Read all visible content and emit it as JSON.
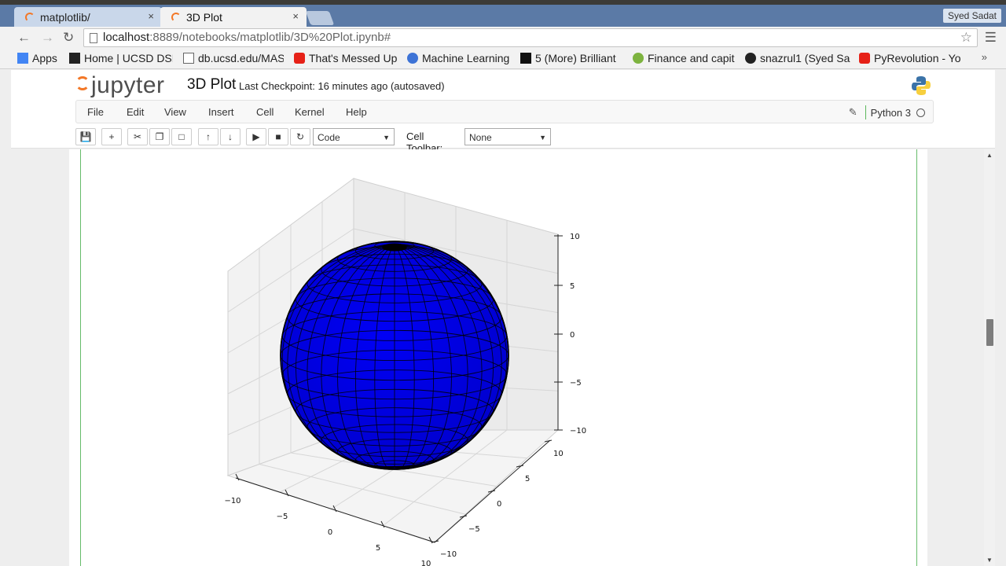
{
  "browser": {
    "tabs": [
      {
        "title": "matplotlib/",
        "active": false
      },
      {
        "title": "3D Plot",
        "active": true
      }
    ],
    "close_glyph": "×",
    "profile_name": "Syed Sadat",
    "url_host": "localhost",
    "url_path": ":8889/notebooks/matplotlib/3D%20Plot.ipynb#",
    "bookmarks": [
      {
        "label": "Apps",
        "icon": "apps-grid-icon"
      },
      {
        "label": "Home | UCSD DSE",
        "icon": "ds-icon"
      },
      {
        "label": "db.ucsd.edu/MAS",
        "icon": "page-icon"
      },
      {
        "label": "That's Messed Up",
        "icon": "youtube-icon"
      },
      {
        "label": "Machine Learning",
        "icon": "link-icon"
      },
      {
        "label": "5 (More) Brilliant",
        "icon": "medium-icon"
      },
      {
        "label": "Finance and capit",
        "icon": "leaf-icon"
      },
      {
        "label": "snazrul1 (Syed Sa",
        "icon": "github-icon"
      },
      {
        "label": "PyRevolution - Yo",
        "icon": "youtube-icon"
      }
    ]
  },
  "jupyter": {
    "logo": "jupyter",
    "notebook_name": "3D Plot",
    "checkpoint": "Last Checkpoint: 16 minutes ago (autosaved)",
    "menu": [
      "File",
      "Edit",
      "View",
      "Insert",
      "Cell",
      "Kernel",
      "Help"
    ],
    "kernel": "Python 3",
    "cell_type": "Code",
    "cell_toolbar_label": "Cell Toolbar:",
    "cell_toolbar_value": "None",
    "toolbar_icons": [
      "save-icon",
      "add-cell-icon",
      "cut-icon",
      "copy-icon",
      "paste-icon",
      "move-up-icon",
      "move-down-icon",
      "run-icon",
      "stop-icon",
      "restart-icon"
    ]
  },
  "plot": {
    "z_ticks": [
      "10",
      "5",
      "0",
      "−5",
      "−10"
    ],
    "x_ticks": [
      "−10",
      "−5",
      "0",
      "5",
      "10"
    ],
    "y_ticks": [
      "10",
      "5",
      "0",
      "−5",
      "−10"
    ],
    "surface_color": "#0000f5"
  },
  "chart_data": {
    "type": "surface",
    "surface": "sphere",
    "radius": 10,
    "center": [
      0,
      0,
      0
    ],
    "color": "blue",
    "xlim": [
      -10,
      10
    ],
    "ylim": [
      -10,
      10
    ],
    "zlim": [
      -10,
      10
    ],
    "grid": true
  }
}
